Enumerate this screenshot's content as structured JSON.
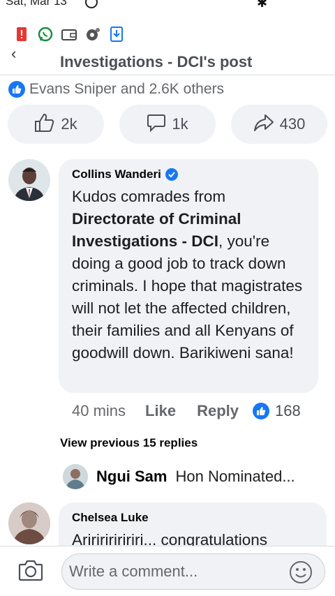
{
  "status": {
    "time": "Sat, Mar 13"
  },
  "notifications": [
    "alert-icon",
    "whatsapp-icon",
    "wallet-icon",
    "podcast-icon",
    "download-icon"
  ],
  "header": {
    "title": "Investigations - DCI's post"
  },
  "reactions": {
    "summary": "Evans Sniper and 2.6K others"
  },
  "actions": {
    "likes": "2k",
    "comments": "1k",
    "shares": "430"
  },
  "comments": [
    {
      "author": "Collins Wanderi",
      "verified": true,
      "text_before": "Kudos comrades from ",
      "mention": "Directorate of Criminal Investigations - DCI",
      "text_after": ", you're doing a good job to track down criminals. I hope that magistrates will not let the affected children, their families and all Kenyans of goodwill down. Barikiweni sana!",
      "time": "40 mins",
      "like_label": "Like",
      "reply_label": "Reply",
      "reaction_count": "168"
    },
    {
      "author": "Chelsea Luke",
      "text": "Aririririririri... congratulations"
    }
  ],
  "replies": {
    "view_previous": "View previous 15 replies",
    "latest_author": "Ngui Sam",
    "latest_text": "Hon Nominated..."
  },
  "composer": {
    "placeholder": "Write a comment..."
  },
  "colors": {
    "accent": "#1877f2",
    "bubble": "#f0f2f5",
    "secondary_text": "#65676b"
  }
}
